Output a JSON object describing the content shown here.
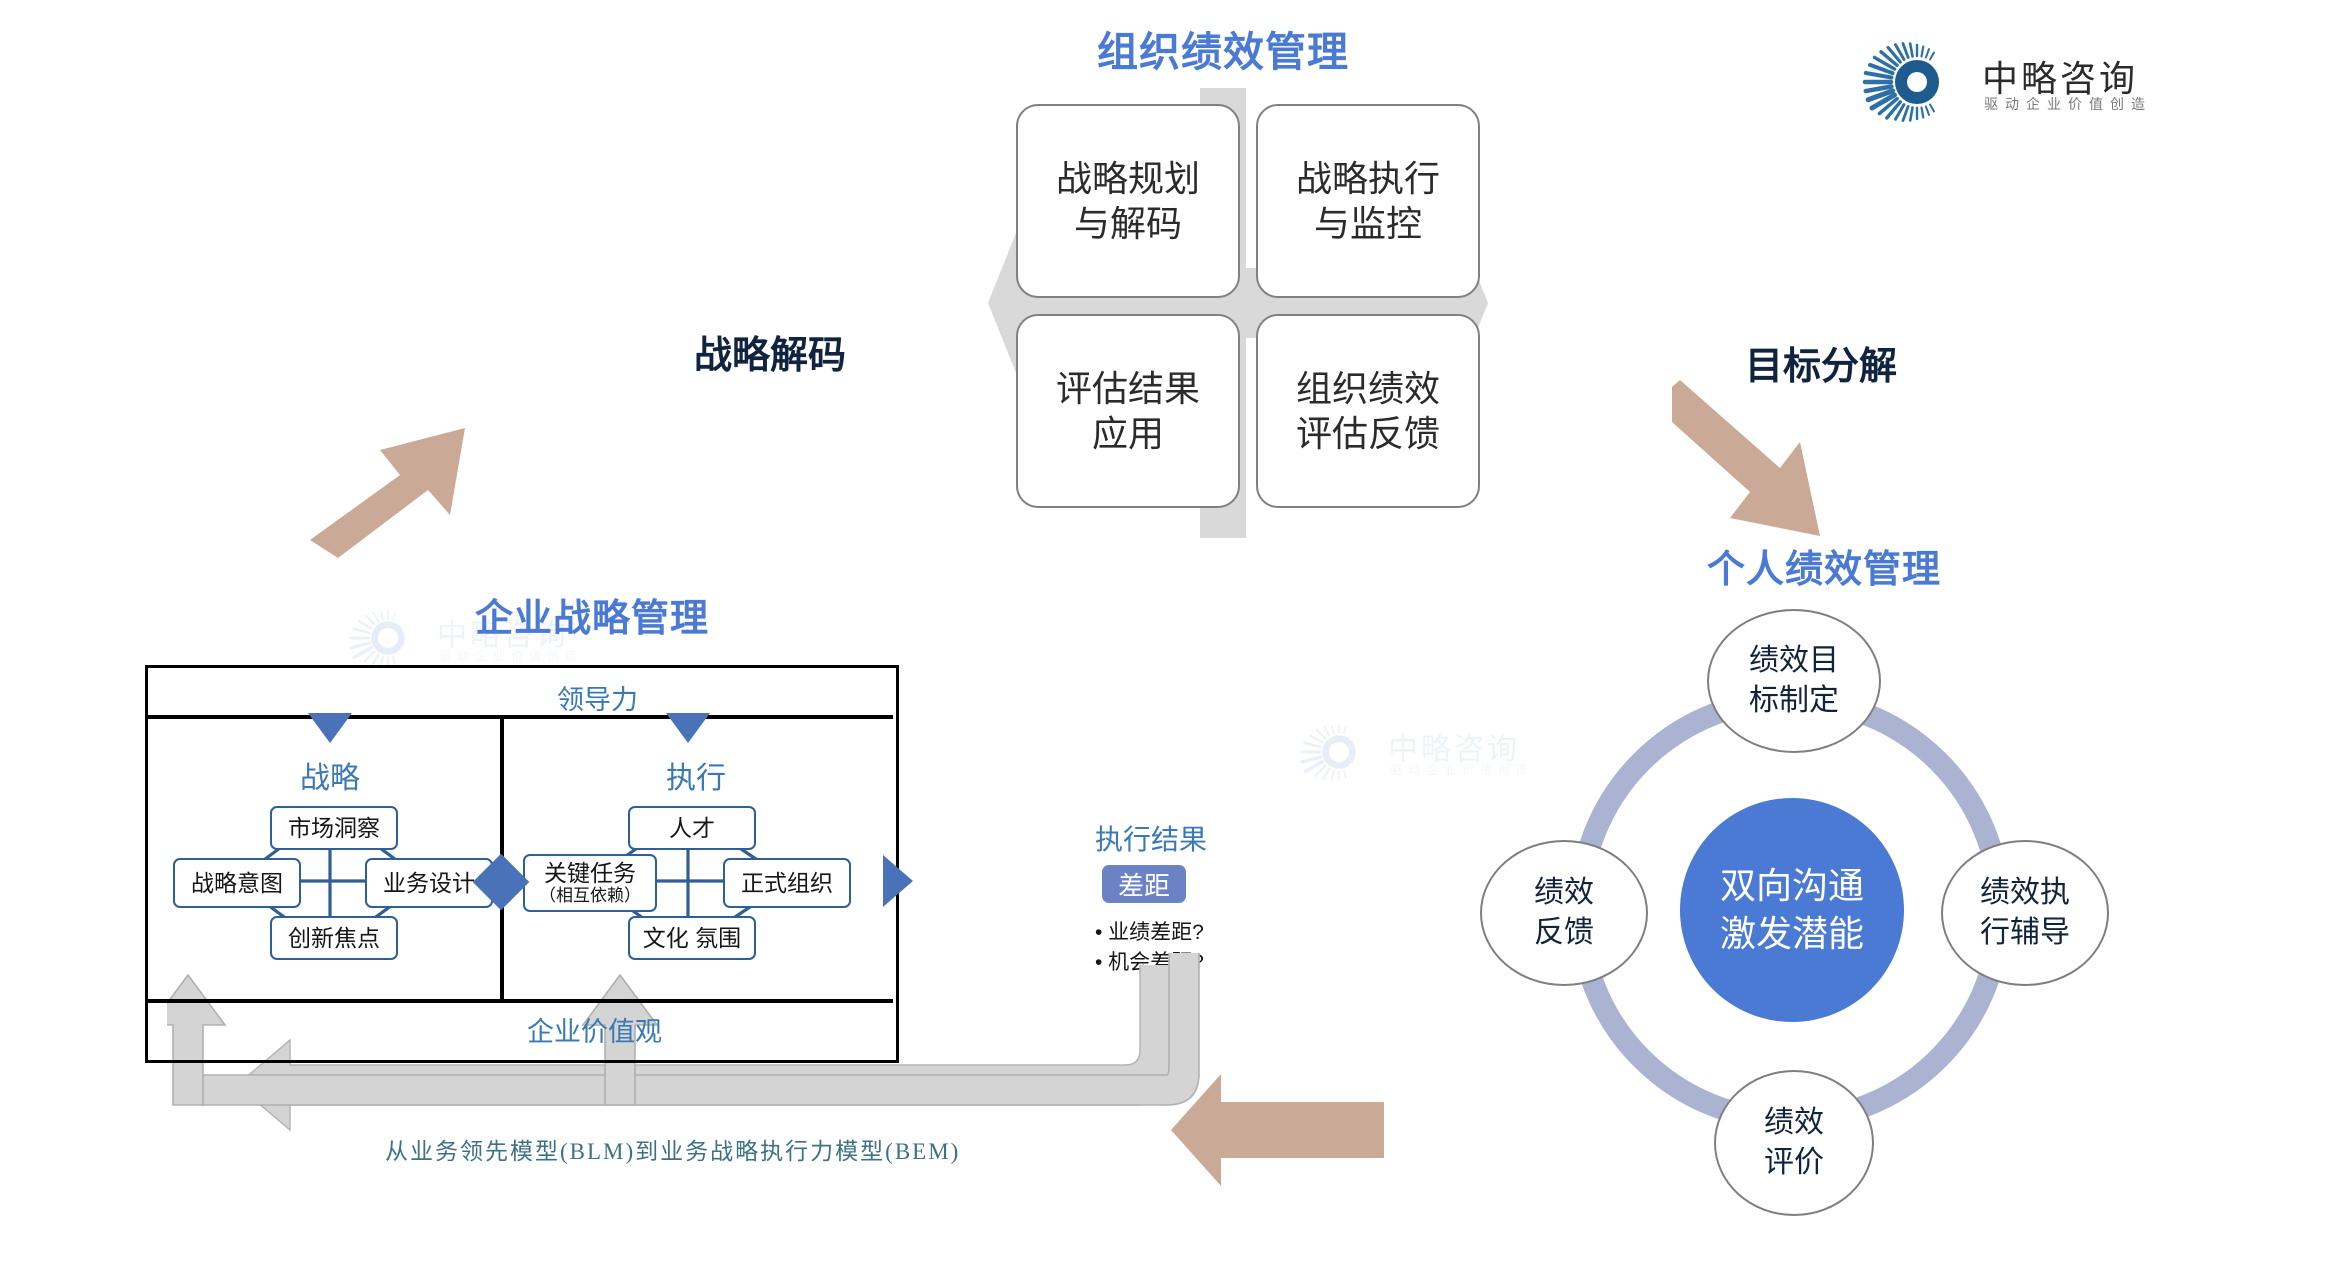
{
  "brand": {
    "name": "中略咨询",
    "tagline": "驱动企业价值创造",
    "accent_blue": "#4a7ad4",
    "arrow_tan": "#cba997",
    "gray": "#d4d4d4"
  },
  "sections": {
    "org_performance_title": "组织绩效管理",
    "enterprise_strategy_title": "企业战略管理",
    "individual_performance_title": "个人绩效管理"
  },
  "arrows": {
    "strategy_decode_label": "战略解码",
    "goal_breakdown_label": "目标分解"
  },
  "org_quadrant": {
    "boxes": [
      {
        "id": "top-left",
        "line1": "战略规划",
        "line2": "与解码"
      },
      {
        "id": "top-right",
        "line1": "战略执行",
        "line2": "与监控"
      },
      {
        "id": "bottom-left",
        "line1": "评估结果",
        "line2": "应用"
      },
      {
        "id": "bottom-right",
        "line1": "组织绩效",
        "line2": "评估反馈"
      }
    ]
  },
  "blm": {
    "leadership": "领导力",
    "values": "企业价值观",
    "strategy_label": "战略",
    "execution_label": "执行",
    "strategy_nodes": {
      "top": "市场洞察",
      "left": "战略意图",
      "right": "业务设计",
      "bottom": "创新焦点"
    },
    "execution_nodes": {
      "top": "人才",
      "left": "关键任务",
      "left_sub": "（相互依赖）",
      "right": "正式组织",
      "bottom": "文化 氛围"
    },
    "result": {
      "title": "执行结果",
      "chip": "差距",
      "bullets": [
        "• 业绩差距?",
        "• 机会差距?"
      ]
    },
    "caption": "从业务领先模型(BLM)到业务战略执行力模型(BEM)"
  },
  "individual_cycle": {
    "core_line1": "双向沟通",
    "core_line2": "激发潜能",
    "nodes": [
      {
        "pos": "top",
        "line1": "绩效目",
        "line2": "标制定"
      },
      {
        "pos": "right",
        "line1": "绩效执",
        "line2": "行辅导"
      },
      {
        "pos": "bottom",
        "line1": "绩效",
        "line2": "评价"
      },
      {
        "pos": "left",
        "line1": "绩效",
        "line2": "反馈"
      }
    ]
  }
}
